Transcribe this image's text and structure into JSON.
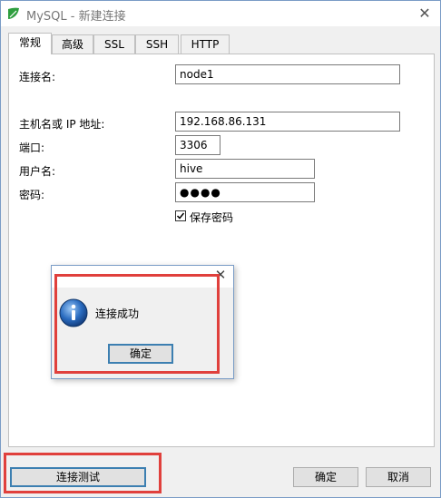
{
  "window": {
    "title": "MySQL - 新建连接"
  },
  "tabs": [
    {
      "label": "常规",
      "active": true
    },
    {
      "label": "高级",
      "active": false
    },
    {
      "label": "SSL",
      "active": false
    },
    {
      "label": "SSH",
      "active": false
    },
    {
      "label": "HTTP",
      "active": false
    }
  ],
  "form": {
    "connection_name_label": "连接名:",
    "connection_name_value": "node1",
    "host_label": "主机名或 IP 地址:",
    "host_value": "192.168.86.131",
    "port_label": "端口:",
    "port_value": "3306",
    "username_label": "用户名:",
    "username_value": "hive",
    "password_label": "密码:",
    "password_value": "●●●●",
    "save_password_label": "保存密码",
    "save_password_checked": true
  },
  "message_box": {
    "text": "连接成功",
    "ok_label": "确定"
  },
  "footer": {
    "test_label": "连接测试",
    "ok_label": "确定",
    "cancel_label": "取消"
  },
  "colors": {
    "highlight_red": "#e0403c",
    "focus_blue": "#3c7fb1",
    "info_blue": "#2a6cc0"
  }
}
